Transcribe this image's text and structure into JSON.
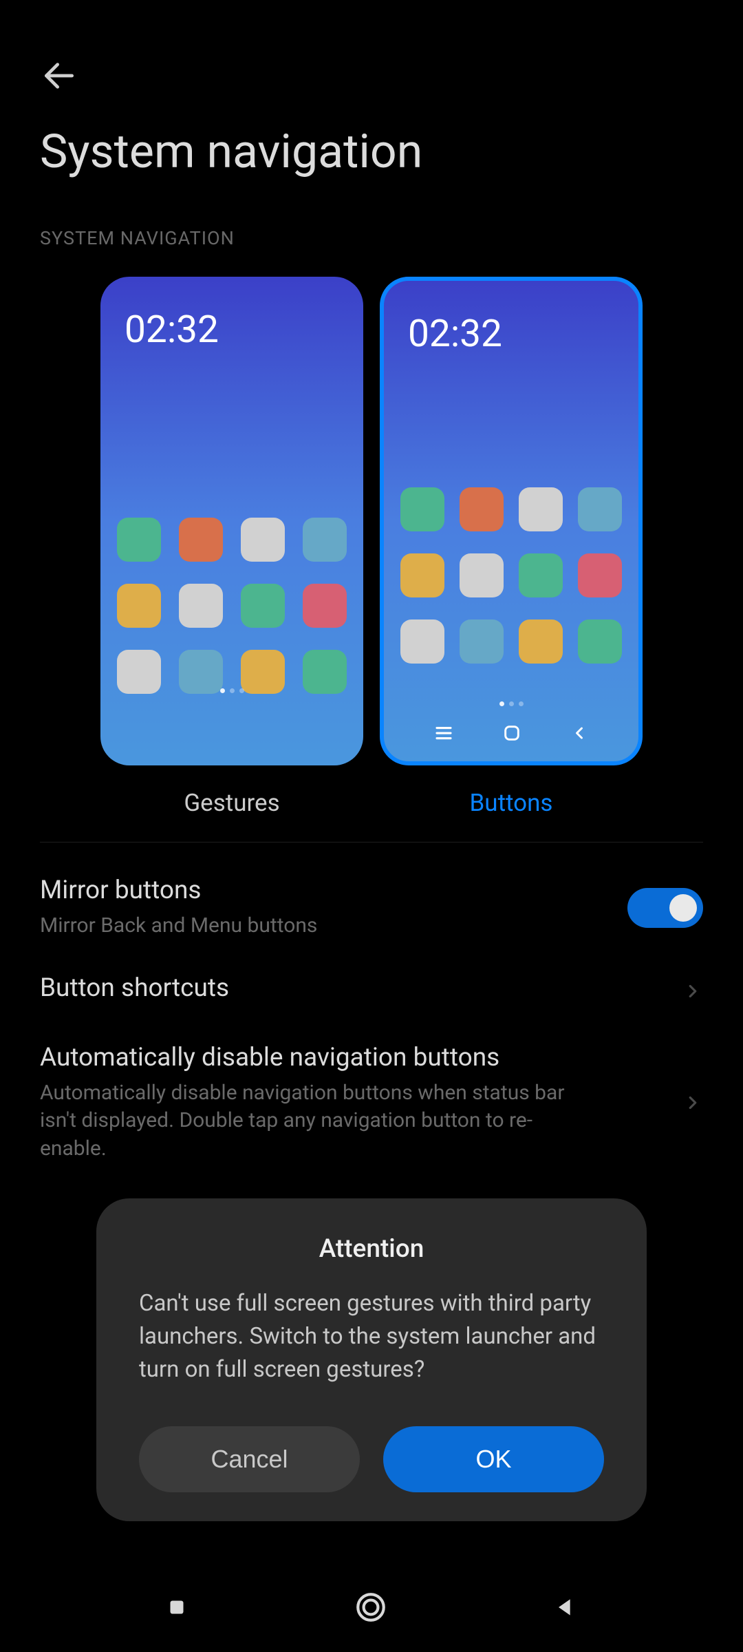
{
  "header": {
    "title": "System navigation"
  },
  "section_label": "SYSTEM NAVIGATION",
  "preview_time": "02:32",
  "options": {
    "gestures": {
      "label": "Gestures",
      "selected": false
    },
    "buttons": {
      "label": "Buttons",
      "selected": true
    }
  },
  "settings": {
    "mirror": {
      "title": "Mirror buttons",
      "subtitle": "Mirror Back and Menu buttons",
      "enabled": true
    },
    "shortcuts": {
      "title": "Button shortcuts"
    },
    "auto_disable": {
      "title": "Automatically disable navigation buttons",
      "subtitle": "Automatically disable navigation buttons when status bar isn't displayed. Double tap any navigation button to re-enable."
    }
  },
  "dialog": {
    "title": "Attention",
    "body": "Can't use full screen gestures with third party launchers. Switch to the system launcher and turn on full screen gestures?",
    "cancel": "Cancel",
    "ok": "OK"
  },
  "colors": {
    "accent": "#0a84ff",
    "switch_on": "#0a6cd6"
  }
}
